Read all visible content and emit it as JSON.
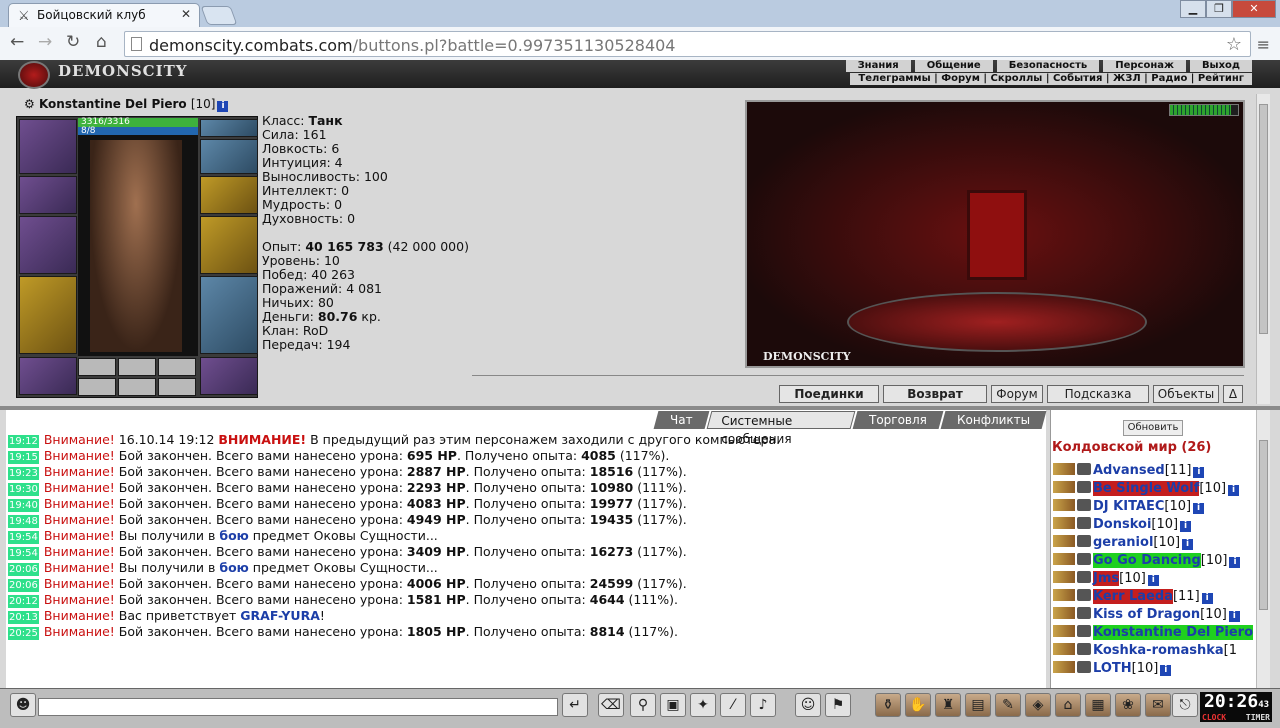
{
  "browser": {
    "tab_title": "Бойцовский клуб",
    "close": "✕",
    "url_domain": "demonscity.combats.com",
    "url_rest": "/buttons.pl?battle=0.997351130528404",
    "min": "▁",
    "max": "❐",
    "close_win": "✕"
  },
  "game": {
    "logo": "DEMONSCITY",
    "menu_top": [
      "Знания",
      "Общение",
      "Безопасность",
      "Персонаж",
      "Выход"
    ],
    "menu_bottom": "Телеграммы | Форум | Скроллы | События | ЖЗЛ | Радио | Рейтинг",
    "char": {
      "name": "Konstantine Del Piero",
      "level": "[10]",
      "hp": "3316/3316",
      "mp": "8/8"
    },
    "stats": {
      "class_label": "Класс:",
      "class_val": "Танк",
      "str": "Сила: 161",
      "agi": "Ловкость: 6",
      "int": "Интуиция: 4",
      "end": "Выносливость: 100",
      "intel": "Интеллект: 0",
      "wis": "Мудрость: 0",
      "spir": "Духовность: 0",
      "exp_label": "Опыт:",
      "exp_val": "40 165 783",
      "exp_next": "(42 000 000)",
      "level": "Уровень: 10",
      "wins": "Побед: 40 263",
      "losses": "Поражений: 4 081",
      "draws": "Ничьих: 80",
      "money_label": "Деньги:",
      "money_val": "80.76",
      "money_unit": "кр.",
      "clan": "Клан: RoD",
      "transfers": "Передач: 194"
    },
    "scene_caption": "DEMONSCITY",
    "buttons": [
      "Поединки",
      "Возврат",
      "Форум",
      "Подсказка",
      "Объекты",
      "Δ"
    ],
    "chat_tabs": [
      "Чат",
      "Системные сообщения",
      "Торговля",
      "Конфликты"
    ],
    "messages": [
      {
        "time": "19:12",
        "warn": "Внимание!",
        "text": " 16.10.14 19:12 ",
        "alert": "ВНИМАНИЕ!",
        "rest": " В предыдущий раз этим персонажем заходили с другого компьютера."
      },
      {
        "time": "19:15",
        "warn": "Внимание!",
        "a": " Бой закончен. Всего вами нанесено урона: ",
        "hp": "695 HP",
        "b": ". Получено опыта: ",
        "exp": "4085",
        "c": " (117%)."
      },
      {
        "time": "19:23",
        "warn": "Внимание!",
        "a": " Бой закончен. Всего вами нанесено урона: ",
        "hp": "2887 HP",
        "b": ". Получено опыта: ",
        "exp": "18516",
        "c": " (117%)."
      },
      {
        "time": "19:30",
        "warn": "Внимание!",
        "a": " Бой закончен. Всего вами нанесено урона: ",
        "hp": "2293 HP",
        "b": ". Получено опыта: ",
        "exp": "10980",
        "c": " (111%)."
      },
      {
        "time": "19:40",
        "warn": "Внимание!",
        "a": " Бой закончен. Всего вами нанесено урона: ",
        "hp": "4083 HP",
        "b": ". Получено опыта: ",
        "exp": "19977",
        "c": " (117%)."
      },
      {
        "time": "19:48",
        "warn": "Внимание!",
        "a": " Бой закончен. Всего вами нанесено урона: ",
        "hp": "4949 HP",
        "b": ". Получено опыта: ",
        "exp": "19435",
        "c": " (117%)."
      },
      {
        "time": "19:54",
        "warn": "Внимание!",
        "item_a": " Вы получили в ",
        "item_link": "бою",
        "item_b": " предмет Оковы Сущности..."
      },
      {
        "time": "19:54",
        "warn": "Внимание!",
        "a": " Бой закончен. Всего вами нанесено урона: ",
        "hp": "3409 HP",
        "b": ". Получено опыта: ",
        "exp": "16273",
        "c": " (117%)."
      },
      {
        "time": "20:06",
        "warn": "Внимание!",
        "item_a": " Вы получили в ",
        "item_link": "бою",
        "item_b": " предмет Оковы Сущности..."
      },
      {
        "time": "20:06",
        "warn": "Внимание!",
        "a": " Бой закончен. Всего вами нанесено урона: ",
        "hp": "4006 HP",
        "b": ". Получено опыта: ",
        "exp": "24599",
        "c": " (117%)."
      },
      {
        "time": "20:12",
        "warn": "Внимание!",
        "a": " Бой закончен. Всего вами нанесено урона: ",
        "hp": "1581 HP",
        "b": ". Получено опыта: ",
        "exp": "4644",
        "c": " (111%)."
      },
      {
        "time": "20:13",
        "warn": "Внимание!",
        "greet_a": " Вас приветствует ",
        "greet_name": "GRAF-YURA",
        "greet_b": "!"
      },
      {
        "time": "20:25",
        "warn": "Внимание!",
        "a": " Бой закончен. Всего вами нанесено урона: ",
        "hp": "1805 HP",
        "b": ". Получено опыта: ",
        "exp": "8814",
        "c": " (117%)."
      }
    ],
    "refresh": "Обновить",
    "room": "Колдовской мир (26)",
    "users": [
      {
        "name": "Advansed",
        "lvl": "[11]",
        "style": ""
      },
      {
        "name": "Be Single Wolf",
        "lvl": "[10]",
        "style": "r"
      },
      {
        "name": "DJ KITAEC",
        "lvl": "[10]",
        "style": ""
      },
      {
        "name": "Donskoi",
        "lvl": "[10]",
        "style": ""
      },
      {
        "name": "geraniol",
        "lvl": "[10]",
        "style": ""
      },
      {
        "name": "Go Go Dancing",
        "lvl": "[10]",
        "style": "gr"
      },
      {
        "name": "Jms",
        "lvl": "[10]",
        "style": "r"
      },
      {
        "name": "Kerr Laeda",
        "lvl": "[11]",
        "style": "r"
      },
      {
        "name": "Kiss of Dragon",
        "lvl": "[10]",
        "style": ""
      },
      {
        "name": "Konstantine Del Piero",
        "lvl": "",
        "style": "gr"
      },
      {
        "name": "Koshka-romashka",
        "lvl": "[1",
        "style": ""
      },
      {
        "name": "LOTH",
        "lvl": "[10]",
        "style": ""
      }
    ],
    "clock": {
      "time": "20:26",
      "sec": "43",
      "label1": "CLOCK",
      "label2": "TIMER"
    }
  }
}
